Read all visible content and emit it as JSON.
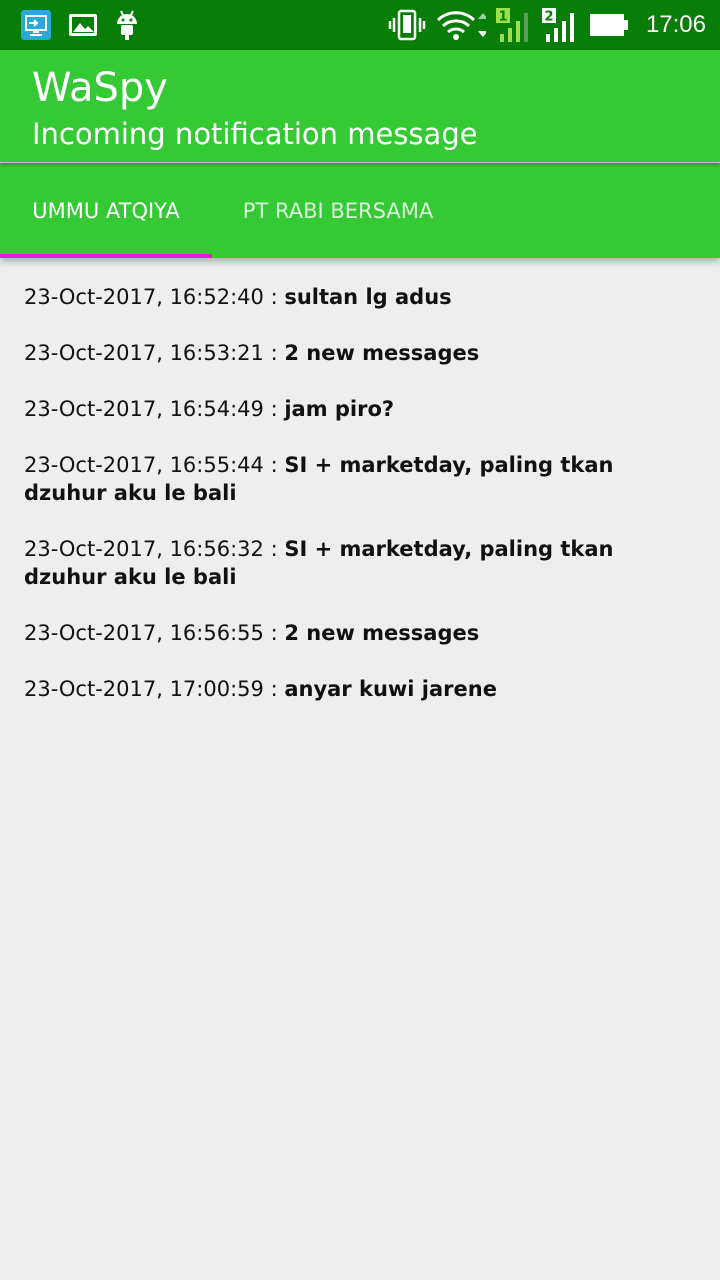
{
  "status_bar": {
    "time": "17:06",
    "sim1_label": "1",
    "sim2_label": "2",
    "icons": [
      "screencast-icon",
      "image-icon",
      "android-icon",
      "vibrate-icon",
      "wifi-icon",
      "signal-sim1-icon",
      "signal-sim2-icon",
      "battery-icon"
    ]
  },
  "app_bar": {
    "title": "WaSpy",
    "subtitle": "Incoming notification message",
    "background": "#36c936"
  },
  "tabs": [
    {
      "label": "UMMU ATQIYA",
      "selected": true
    },
    {
      "label": "PT RABI BERSAMA",
      "selected": false
    }
  ],
  "accent": "#e91ec9",
  "messages": [
    {
      "time": "23-Oct-2017, 16:52:40",
      "separator": " : ",
      "text": "sultan lg adus"
    },
    {
      "time": "23-Oct-2017, 16:53:21",
      "separator": " : ",
      "text": "2 new messages"
    },
    {
      "time": "23-Oct-2017, 16:54:49",
      "separator": " : ",
      "text": "jam piro?"
    },
    {
      "time": "23-Oct-2017, 16:55:44",
      "separator": " : ",
      "text": "SI + marketday, paling tkan dzuhur aku le bali"
    },
    {
      "time": "23-Oct-2017, 16:56:32",
      "separator": " : ",
      "text": "SI + marketday, paling tkan dzuhur aku le bali"
    },
    {
      "time": "23-Oct-2017, 16:56:55",
      "separator": " : ",
      "text": "2 new messages"
    },
    {
      "time": "23-Oct-2017, 17:00:59",
      "separator": " : ",
      "text": "anyar kuwi jarene"
    }
  ]
}
